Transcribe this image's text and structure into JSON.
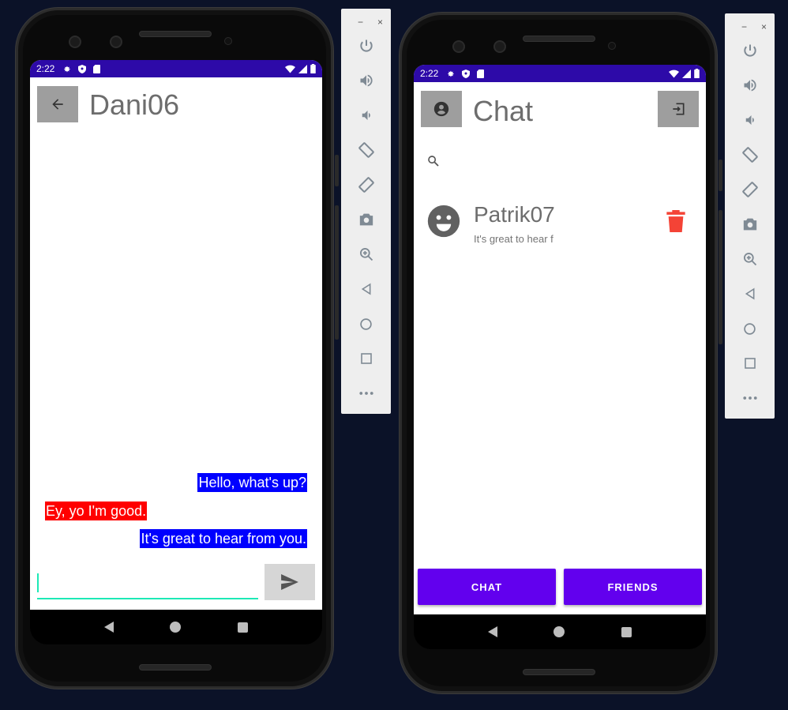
{
  "left_phone": {
    "status_time": "2:22",
    "title": "Dani06",
    "messages": [
      {
        "text": "Hello, what's up?",
        "side": "right",
        "color": "#0000ff"
      },
      {
        "text": "Ey, yo I'm good.",
        "side": "left",
        "color": "#ff0000"
      },
      {
        "text": "It's great to hear from you.",
        "side": "right",
        "color": "#0000ff"
      }
    ],
    "input_value": "",
    "accent": "#1de9b6"
  },
  "right_phone": {
    "status_time": "2:22",
    "title": "Chat",
    "search_placeholder": "",
    "chat_item": {
      "name": "Patrik07",
      "preview": "It's great to hear f"
    },
    "tabs": {
      "chat": "CHAT",
      "friends": "FRIENDS"
    },
    "brand_color": "#6200ee",
    "delete_color": "#f44336"
  },
  "toolbar_icons": [
    "power-icon",
    "volume-up-icon",
    "volume-down-icon",
    "rotate-left-icon",
    "rotate-right-icon",
    "camera-icon",
    "zoom-icon",
    "back-icon",
    "home-icon",
    "overview-icon",
    "more-icon"
  ],
  "toolbar_head": {
    "minimize": "−",
    "close": "×"
  }
}
